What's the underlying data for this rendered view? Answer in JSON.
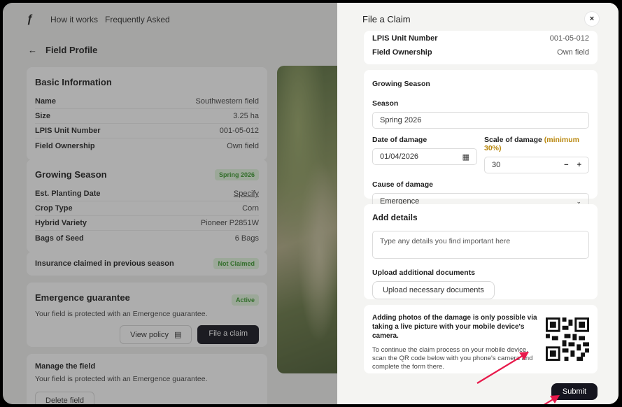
{
  "nav": {
    "link1": "How it works",
    "link2": "Frequently Asked"
  },
  "field_profile": {
    "back_icon": "arrow-left-icon",
    "title": "Field Profile"
  },
  "basic_info": {
    "title": "Basic Information",
    "rows": [
      {
        "k": "Name",
        "v": "Southwestern field"
      },
      {
        "k": "Size",
        "v": "3.25 ha"
      },
      {
        "k": "LPIS Unit Number",
        "v": "001-05-012"
      },
      {
        "k": "Field Ownership",
        "v": "Own field"
      }
    ]
  },
  "growing_season": {
    "title": "Growing Season",
    "badge": "Spring 2026",
    "rows": [
      {
        "k": "Est. Planting Date",
        "v": "Specify"
      },
      {
        "k": "Crop Type",
        "v": "Corn"
      },
      {
        "k": "Hybrid Variety",
        "v": "Pioneer P2851W"
      },
      {
        "k": "Bags of Seed",
        "v": "6 Bags"
      }
    ]
  },
  "insurance": {
    "label": "Insurance claimed in previous season",
    "badge": "Not Claimed"
  },
  "emergence": {
    "title": "Emergence guarantee",
    "badge": "Active",
    "text": "Your field is protected with an Emergence guarantee.",
    "view_policy": "View policy",
    "file_claim": "File a claim"
  },
  "manage": {
    "title": "Manage the field",
    "text": "Your field is protected with an Emergence guarantee.",
    "delete": "Delete field"
  },
  "drawer": {
    "title": "File a Claim",
    "close": "×",
    "top_rows": [
      {
        "k": "LPIS Unit Number",
        "v": "001-05-012"
      },
      {
        "k": "Field Ownership",
        "v": "Own field"
      }
    ],
    "growing": {
      "title": "Growing Season",
      "season_label": "Season",
      "season_value": "Spring 2026",
      "date_label": "Date of damage",
      "date_value": "01/04/2026",
      "scale_label": "Scale of damage",
      "scale_min": "(minimum 30%)",
      "scale_value": "30",
      "minus": "−",
      "plus": "+",
      "cause_label": "Cause of damage",
      "cause_value": "Emergence"
    },
    "details": {
      "title": "Add details",
      "placeholder": "Type any details you find important here",
      "upload_label": "Upload additional documents",
      "upload_button": "Upload necessary documents"
    },
    "photos": {
      "heading": "Adding photos of the damage is only possible via taking a live picture with your mobile device's camera.",
      "text": "To continue the claim process on your mobile device, scan the QR code below with you phone's camera and complete the form there."
    },
    "submit": "Submit"
  },
  "colors": {
    "accent_dark": "#15151f",
    "badge_green": "#3a9a2e",
    "arrow_red": "#e8194b",
    "min_gold": "#b8860b"
  }
}
